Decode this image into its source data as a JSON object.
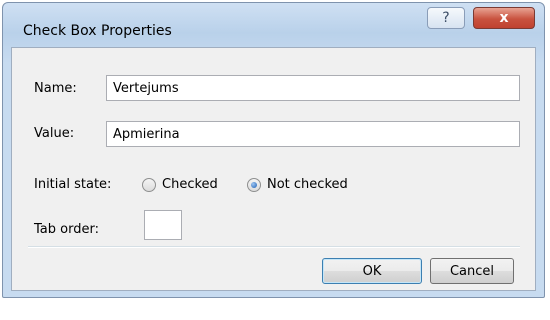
{
  "window": {
    "title": "Check Box Properties",
    "help_glyph": "?",
    "close_glyph": "x"
  },
  "form": {
    "name_label": "Name:",
    "name_value": "Vertejums",
    "value_label": "Value:",
    "value_value": "Apmierina",
    "initial_state_label": "Initial state:",
    "options": [
      {
        "label": "Checked",
        "selected": false
      },
      {
        "label": "Not checked",
        "selected": true
      }
    ],
    "tab_order_label": "Tab order:",
    "tab_order_value": ""
  },
  "buttons": {
    "ok_label": "OK",
    "cancel_label": "Cancel"
  },
  "icons": {
    "help": "help-icon",
    "close": "close-icon",
    "radio_checked": "radio-checked-icon",
    "radio_unchecked": "radio-unchecked-icon"
  }
}
